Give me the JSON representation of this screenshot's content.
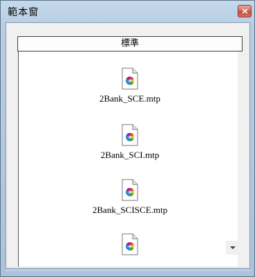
{
  "window": {
    "title": "範本窗"
  },
  "list": {
    "header": "標準",
    "items": [
      {
        "label": "2Bank_SCE.mtp",
        "icon": "color-wheel-file-icon"
      },
      {
        "label": "2Bank_SCI.mtp",
        "icon": "color-wheel-file-icon"
      },
      {
        "label": "2Bank_SCISCE.mtp",
        "icon": "color-wheel-file-icon"
      },
      {
        "label": "",
        "icon": "color-wheel-file-icon"
      }
    ]
  },
  "colors": {
    "title_bar": "#c5d9ec",
    "close_button": "#d0675a",
    "client_bg": "#f0f0f0",
    "list_bg": "#ffffff"
  }
}
